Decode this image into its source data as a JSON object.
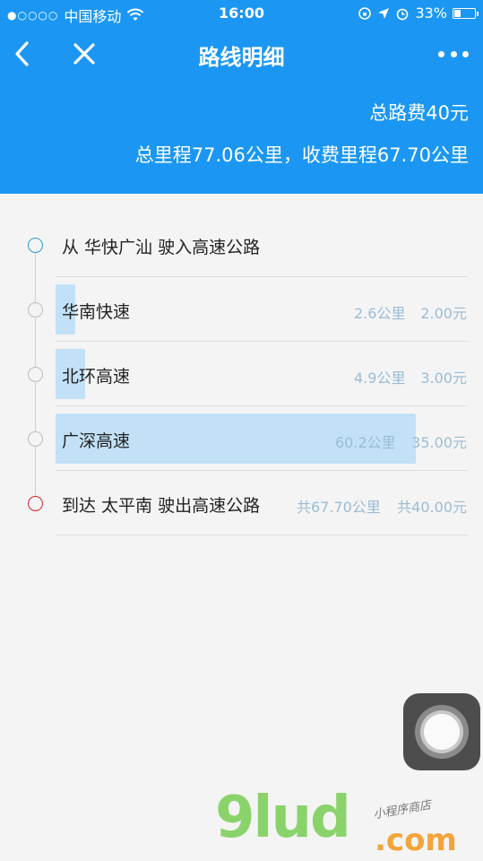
{
  "status_bar": {
    "signal": "●○○○○",
    "carrier": "中国移动",
    "time": "16:00",
    "battery_text": "33%",
    "battery_level": 0.33
  },
  "header": {
    "title": "路线明细",
    "total_fee": "总路费40元",
    "total_distance": "总里程77.06公里，收费里程67.70公里"
  },
  "route": {
    "start_label": "从 华快广汕 驶入高速公路",
    "segments": [
      {
        "name": "华南快速",
        "distance": "2.6公里",
        "cost": "2.00元",
        "share": 0.043
      },
      {
        "name": "北环高速",
        "distance": "4.9公里",
        "cost": "3.00元",
        "share": 0.081
      },
      {
        "name": "广深高速",
        "distance": "60.2公里",
        "cost": "35.00元",
        "share": 1.0
      }
    ],
    "end_label": "到达 太平南 驶出高速公路",
    "end_distance": "共67.70公里",
    "end_cost": "共40.00元"
  },
  "watermark": {
    "logo": "9lud",
    "domain": ".com",
    "tagline": "小程序商店"
  },
  "colors": {
    "header_bg": "#1b97f3",
    "bar_fill": "#c2e1f7",
    "start_node": "#2c9ad6",
    "end_node": "#d2262b"
  }
}
